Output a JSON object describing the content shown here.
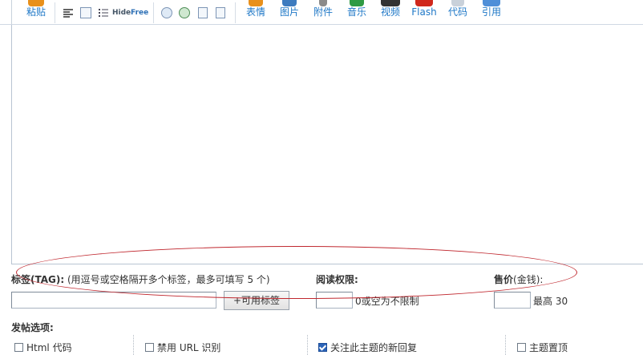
{
  "toolbar": {
    "paste_label": "粘贴",
    "hide_label": "Hide",
    "free_label": "Free",
    "buttons": [
      {
        "label": "表情",
        "icon": "emoticon-icon",
        "color": "#e8901b"
      },
      {
        "label": "图片",
        "icon": "image-icon",
        "color": "#3c7bbf"
      },
      {
        "label": "附件",
        "icon": "attachment-icon",
        "color": "#8a8a8a"
      },
      {
        "label": "音乐",
        "icon": "music-icon",
        "color": "#2f9a44"
      },
      {
        "label": "视频",
        "icon": "video-icon",
        "color": "#333333"
      },
      {
        "label": "Flash",
        "icon": "flash-icon",
        "color": "#d0281c"
      },
      {
        "label": "代码",
        "icon": "code-icon",
        "color": "#9aa6b3"
      },
      {
        "label": "引用",
        "icon": "quote-icon",
        "color": "#4f8fd8"
      }
    ]
  },
  "tags": {
    "label": "标签(TAG):",
    "hint": " (用逗号或空格隔开多个标签，最多可填写 5 个)",
    "value": "",
    "available_button": "+可用标签"
  },
  "read_permission": {
    "label": "阅读权限:",
    "value": "",
    "note": "0或空为不限制"
  },
  "price": {
    "label": "售价",
    "unit": "(金钱):",
    "value": "",
    "max_note": "最高 30"
  },
  "post_options": {
    "title": "发帖选项:",
    "options": [
      {
        "label": "Html 代码",
        "checked": false
      },
      {
        "label": "禁用 URL 识别",
        "checked": false
      },
      {
        "label": "关注此主题的新回复",
        "checked": true
      },
      {
        "label": "主题置顶",
        "checked": false
      }
    ]
  }
}
